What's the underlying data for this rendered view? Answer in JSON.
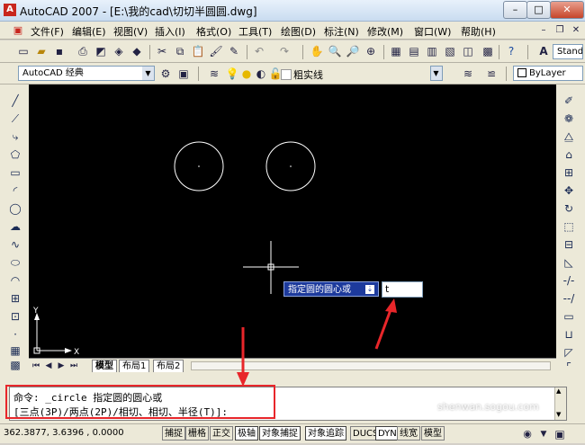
{
  "window": {
    "title": "AutoCAD 2007 - [E:\\我的cad\\切切半圆圆.dwg]",
    "app_icon": "A"
  },
  "menu": [
    "文件(F)",
    "编辑(E)",
    "视图(V)",
    "插入(I)",
    "格式(O)",
    "工具(T)",
    "绘图(D)",
    "标注(N)",
    "修改(M)",
    "窗口(W)",
    "帮助(H)"
  ],
  "toolbar2": {
    "workspace": "AutoCAD 经典",
    "linetype": "粗实线",
    "color": "ByLayer",
    "text_style": "Standa"
  },
  "tabs": {
    "model": "模型",
    "layout1": "布局1",
    "layout2": "布局2"
  },
  "ucs": {
    "x": "X",
    "y": "Y"
  },
  "dynamic_input": {
    "prompt": "指定圆的圆心或",
    "value": "t"
  },
  "command": {
    "line1": "命令: _circle 指定圆的圆心或",
    "line2": "[三点(3P)/两点(2P)/相切、相切、半径(T)]:"
  },
  "status": {
    "coords": "362.3877, 3.6396  , 0.0000",
    "buttons": [
      "捕捉",
      "栅格",
      "正交",
      "极轴",
      "对象捕捉",
      "对象追踪",
      "DUCS",
      "DYN",
      "线宽",
      "模型"
    ]
  },
  "watermark": "shenwan.sogou.com"
}
